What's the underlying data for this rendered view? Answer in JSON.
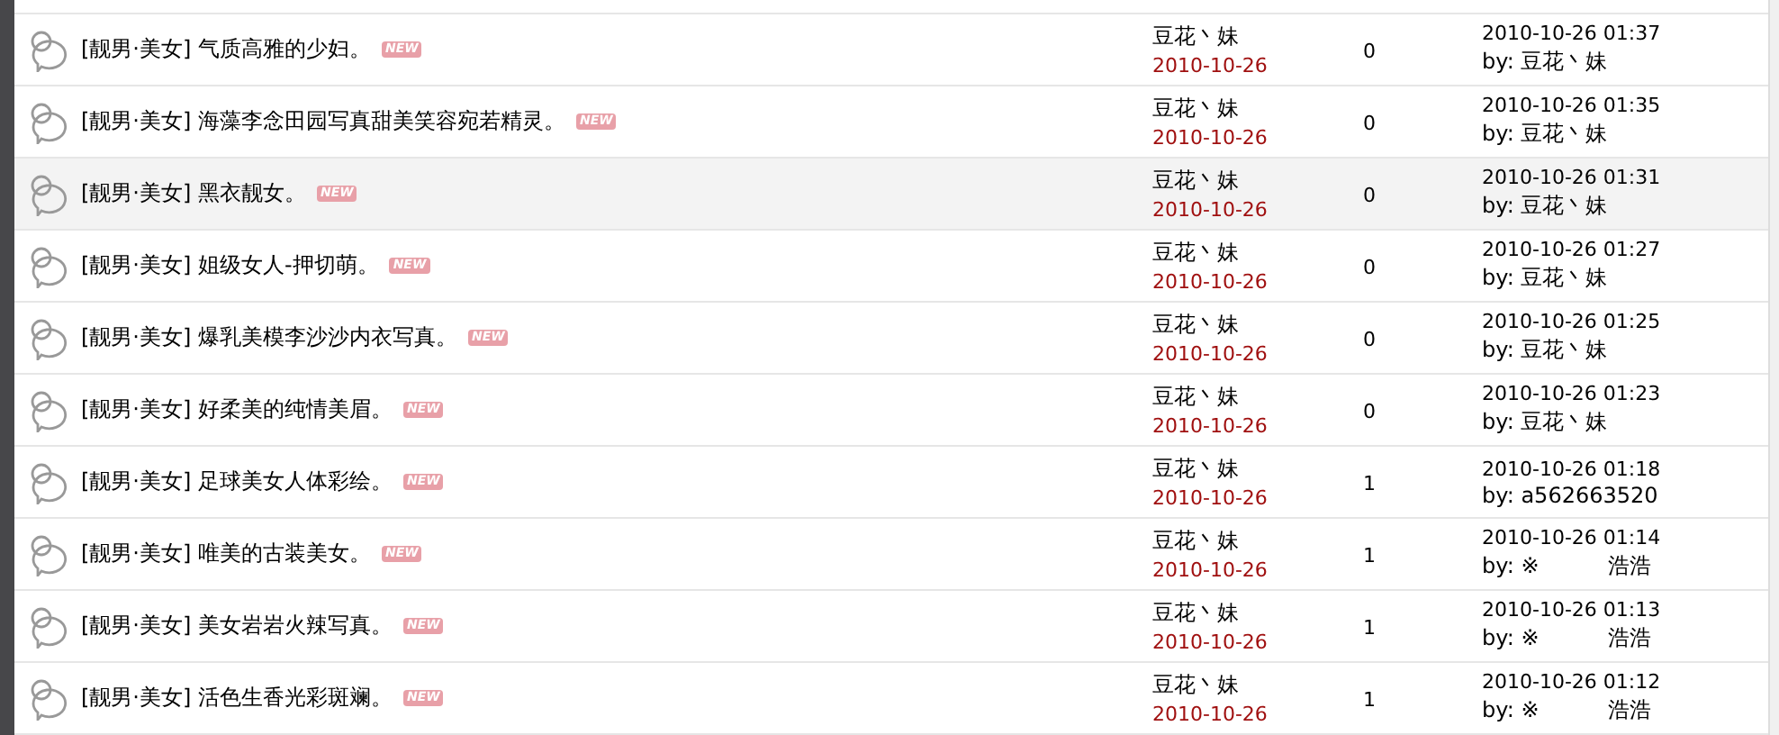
{
  "rows": [
    {
      "title": "[靓男·美女] 气质高雅的少妇。",
      "badge": "NEW",
      "highlighted": false,
      "author": "豆花丶妹",
      "date": "2010-10-26",
      "replies": "0",
      "last_time": "2010-10-26 01:37",
      "last_by": "by: 豆花丶妹"
    },
    {
      "title": "[靓男·美女] 海藻李念田园写真甜美笑容宛若精灵。",
      "badge": "NEW",
      "highlighted": false,
      "author": "豆花丶妹",
      "date": "2010-10-26",
      "replies": "0",
      "last_time": "2010-10-26 01:35",
      "last_by": "by: 豆花丶妹"
    },
    {
      "title": "[靓男·美女] 黑衣靓女。",
      "badge": "NEW",
      "highlighted": true,
      "author": "豆花丶妹",
      "date": "2010-10-26",
      "replies": "0",
      "last_time": "2010-10-26 01:31",
      "last_by": "by: 豆花丶妹"
    },
    {
      "title": "[靓男·美女] 姐级女人-押切萌。",
      "badge": "NEW",
      "highlighted": false,
      "author": "豆花丶妹",
      "date": "2010-10-26",
      "replies": "0",
      "last_time": "2010-10-26 01:27",
      "last_by": "by: 豆花丶妹"
    },
    {
      "title": "[靓男·美女] 爆乳美模李沙沙内衣写真。",
      "badge": "NEW",
      "highlighted": false,
      "author": "豆花丶妹",
      "date": "2010-10-26",
      "replies": "0",
      "last_time": "2010-10-26 01:25",
      "last_by": "by: 豆花丶妹"
    },
    {
      "title": "[靓男·美女] 好柔美的纯情美眉。",
      "badge": "NEW",
      "highlighted": false,
      "author": "豆花丶妹",
      "date": "2010-10-26",
      "replies": "0",
      "last_time": "2010-10-26 01:23",
      "last_by": "by: 豆花丶妹"
    },
    {
      "title": "[靓男·美女] 足球美女人体彩绘。",
      "badge": "NEW",
      "highlighted": false,
      "author": "豆花丶妹",
      "date": "2010-10-26",
      "replies": "1",
      "last_time": "2010-10-26 01:18",
      "last_by": "by: a562663520"
    },
    {
      "title": "[靓男·美女] 唯美的古装美女。",
      "badge": "NEW",
      "highlighted": false,
      "author": "豆花丶妹",
      "date": "2010-10-26",
      "replies": "1",
      "last_time": "2010-10-26 01:14",
      "last_by": "by: ※          浩浩"
    },
    {
      "title": "[靓男·美女] 美女岩岩火辣写真。",
      "badge": "NEW",
      "highlighted": false,
      "author": "豆花丶妹",
      "date": "2010-10-26",
      "replies": "1",
      "last_time": "2010-10-26 01:13",
      "last_by": "by: ※          浩浩"
    },
    {
      "title": "[靓男·美女] 活色生香光彩斑斓。",
      "badge": "NEW",
      "highlighted": false,
      "author": "豆花丶妹",
      "date": "2010-10-26",
      "replies": "1",
      "last_time": "2010-10-26 01:12",
      "last_by": "by: ※          浩浩"
    }
  ]
}
